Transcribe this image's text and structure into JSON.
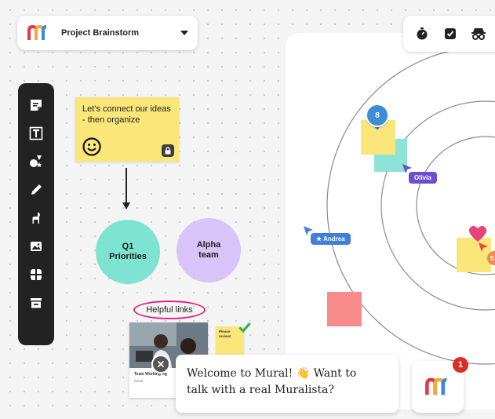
{
  "project": {
    "title": "Project Brainstorm"
  },
  "sticky": {
    "text": "Let's connect our ideas - then organize"
  },
  "nodes": {
    "q1": "Q1 Priorities",
    "alpha": "Alpha team"
  },
  "links": {
    "label": "Helpful links",
    "card_caption": "Team Working Ag",
    "card_source": "Mural",
    "mini_sticky": "Please review!"
  },
  "target": {
    "pin_count": "8",
    "cursor_olivia": "Olivia",
    "cursor_andrea": "Andrea",
    "orange_badge": "5"
  },
  "chat": {
    "message_line1": "Welcome to Mural! 👋 Want to",
    "message_line2": "talk with a real Muralista?",
    "badge_count": "1"
  },
  "colors": {
    "accent_blue": "#3d8dd6",
    "olivia": "#6b4fcf",
    "andrea": "#3f7fd8",
    "sticky_yellow": "#fbe67a",
    "teal": "#7fe3d1",
    "lavender": "#d8c4f8",
    "helpful_ring": "#e0267a",
    "badge_red": "#d93025"
  }
}
